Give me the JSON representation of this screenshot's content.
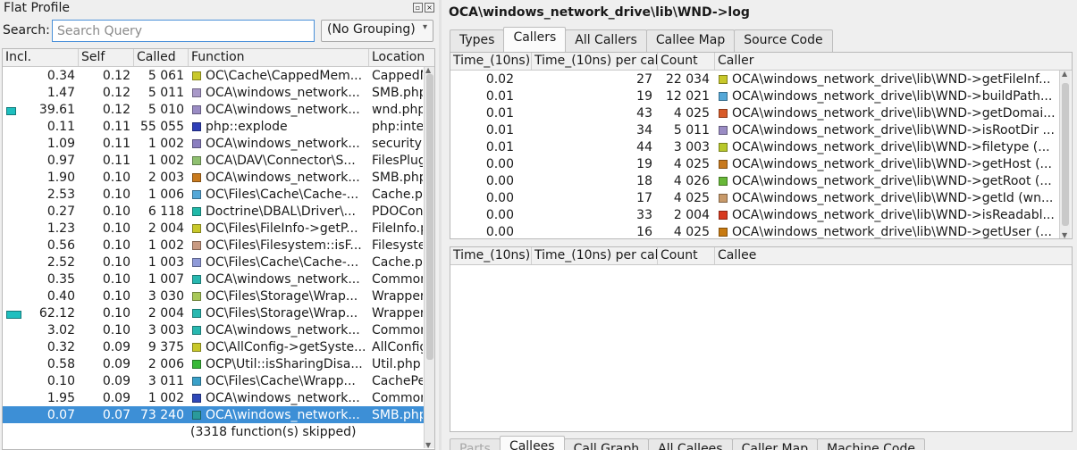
{
  "left_panel": {
    "title": "Flat Profile",
    "float_btn": "▫",
    "close_btn": "×",
    "search_label": "Search:",
    "search_placeholder": "Search Query",
    "grouping": "(No Grouping)",
    "columns": [
      "Incl.",
      "Self",
      "Called",
      "Function",
      "Location"
    ],
    "rows": [
      {
        "incl": "0.34",
        "self": "0.12",
        "called": "5 061",
        "func": "OC\\Cache\\CappedMem...",
        "loc": "CappedM",
        "color": "#c8c82a"
      },
      {
        "incl": "1.47",
        "self": "0.12",
        "called": "5 011",
        "func": "OCA\\windows_network...",
        "loc": "SMB.php",
        "color": "#a999c9"
      },
      {
        "incl": "39.61",
        "self": "0.12",
        "called": "5 010",
        "func": "OCA\\windows_network...",
        "loc": "wnd.php",
        "color": "#9a8cc4",
        "bar": 0.13
      },
      {
        "incl": "0.11",
        "self": "0.11",
        "called": "55 055",
        "func": "php::explode",
        "loc": "php:inte",
        "color": "#2f3fb8"
      },
      {
        "incl": "1.09",
        "self": "0.11",
        "called": "1 002",
        "func": "OCA\\windows_network...",
        "loc": "security",
        "color": "#8a7ec0"
      },
      {
        "incl": "0.97",
        "self": "0.11",
        "called": "1 002",
        "func": "OCA\\DAV\\Connector\\S...",
        "loc": "FilesPlug",
        "color": "#8fc070"
      },
      {
        "incl": "1.90",
        "self": "0.10",
        "called": "2 003",
        "func": "OCA\\windows_network...",
        "loc": "SMB.php",
        "color": "#c87a1e"
      },
      {
        "incl": "2.53",
        "self": "0.10",
        "called": "1 006",
        "func": "OC\\Files\\Cache\\Cache-...",
        "loc": "Cache.ph",
        "color": "#55a8d8"
      },
      {
        "incl": "0.27",
        "self": "0.10",
        "called": "6 118",
        "func": "Doctrine\\DBAL\\Driver\\...",
        "loc": "PDOCon",
        "color": "#20b8a8"
      },
      {
        "incl": "1.23",
        "self": "0.10",
        "called": "2 004",
        "func": "OC\\Files\\FileInfo->getP...",
        "loc": "FileInfo.p",
        "color": "#c8c82a"
      },
      {
        "incl": "0.56",
        "self": "0.10",
        "called": "1 002",
        "func": "OC\\Files\\Filesystem::isF...",
        "loc": "Filesyste",
        "color": "#c89a82"
      },
      {
        "incl": "2.52",
        "self": "0.10",
        "called": "1 003",
        "func": "OC\\Files\\Cache\\Cache-...",
        "loc": "Cache.ph",
        "color": "#8f9ad8"
      },
      {
        "incl": "0.35",
        "self": "0.10",
        "called": "1 007",
        "func": "OCA\\windows_network...",
        "loc": "Common",
        "color": "#28b8b0"
      },
      {
        "incl": "0.40",
        "self": "0.10",
        "called": "3 030",
        "func": "OC\\Files\\Storage\\Wrap...",
        "loc": "Wrapper",
        "color": "#a8c858"
      },
      {
        "incl": "62.12",
        "self": "0.10",
        "called": "2 004",
        "func": "OC\\Files\\Storage\\Wrap...",
        "loc": "Wrapper",
        "color": "#28b8b0",
        "bar": 0.2
      },
      {
        "incl": "3.02",
        "self": "0.10",
        "called": "3 003",
        "func": "OCA\\windows_network...",
        "loc": "Common",
        "color": "#28b8b0"
      },
      {
        "incl": "0.32",
        "self": "0.09",
        "called": "9 375",
        "func": "OC\\AllConfig->getSyste...",
        "loc": "AllConfig",
        "color": "#c8c82a"
      },
      {
        "incl": "0.58",
        "self": "0.09",
        "called": "2 006",
        "func": "OCP\\Util::isSharingDisa...",
        "loc": "Util.php",
        "color": "#38b838"
      },
      {
        "incl": "0.10",
        "self": "0.09",
        "called": "3 011",
        "func": "OC\\Files\\Cache\\Wrapp...",
        "loc": "CachePe",
        "color": "#3aa0c8"
      },
      {
        "incl": "1.95",
        "self": "0.09",
        "called": "1 002",
        "func": "OCA\\windows_network...",
        "loc": "Common",
        "color": "#2f48b8"
      },
      {
        "incl": "0.07",
        "self": "0.07",
        "called": "73 240",
        "func": "OCA\\windows_network...",
        "loc": "SMB.php",
        "color": "#2a9a9a",
        "selected": true
      }
    ],
    "skipped": "(3318 function(s) skipped)"
  },
  "right_panel": {
    "title": "OCA\\windows_network_drive\\lib\\WND->log",
    "top_tabs": [
      {
        "label": "Types",
        "active": false
      },
      {
        "label": "Callers",
        "active": true
      },
      {
        "label": "All Callers",
        "active": false
      },
      {
        "label": "Callee Map",
        "active": false
      },
      {
        "label": "Source Code",
        "active": false
      }
    ],
    "callers_columns": [
      "Time_(10ns)",
      "Time_(10ns) per call",
      "Count",
      "Caller"
    ],
    "callers_rows": [
      {
        "time": "0.02",
        "per_call": "27",
        "count": "22 034",
        "name": "OCA\\windows_network_drive\\lib\\WND->getFileInf...",
        "color": "#c8c82a"
      },
      {
        "time": "0.01",
        "per_call": "19",
        "count": "12 021",
        "name": "OCA\\windows_network_drive\\lib\\WND->buildPath...",
        "color": "#55a8d8"
      },
      {
        "time": "0.01",
        "per_call": "43",
        "count": "4 025",
        "name": "OCA\\windows_network_drive\\lib\\WND->getDomai...",
        "color": "#d85a28"
      },
      {
        "time": "0.01",
        "per_call": "34",
        "count": "5 011",
        "name": "OCA\\windows_network_drive\\lib\\WND->isRootDir ...",
        "color": "#9a8cc4"
      },
      {
        "time": "0.01",
        "per_call": "44",
        "count": "3 003",
        "name": "OCA\\windows_network_drive\\lib\\WND->filetype (...",
        "color": "#b8c82a"
      },
      {
        "time": "0.00",
        "per_call": "19",
        "count": "4 025",
        "name": "OCA\\windows_network_drive\\lib\\WND->getHost (...",
        "color": "#c87a1e"
      },
      {
        "time": "0.00",
        "per_call": "18",
        "count": "4 026",
        "name": "OCA\\windows_network_drive\\lib\\WND->getRoot (...",
        "color": "#68b838"
      },
      {
        "time": "0.00",
        "per_call": "17",
        "count": "4 025",
        "name": "OCA\\windows_network_drive\\lib\\WND->getId (wn...",
        "color": "#c89a6a"
      },
      {
        "time": "0.00",
        "per_call": "33",
        "count": "2 004",
        "name": "OCA\\windows_network_drive\\lib\\WND->isReadabl...",
        "color": "#d83a20"
      },
      {
        "time": "0.00",
        "per_call": "16",
        "count": "4 025",
        "name": "OCA\\windows_network_drive\\lib\\WND->getUser (...",
        "color": "#c87a10"
      }
    ],
    "callees_columns": [
      "Time_(10ns)",
      "Time_(10ns) per call",
      "Count",
      "Callee"
    ],
    "bottom_tabs": [
      {
        "label": "Parts",
        "active": false,
        "disabled": true
      },
      {
        "label": "Callees",
        "active": true
      },
      {
        "label": "Call Graph",
        "active": false
      },
      {
        "label": "All Callees",
        "active": false
      },
      {
        "label": "Caller Map",
        "active": false
      },
      {
        "label": "Machine Code",
        "active": false
      }
    ]
  }
}
